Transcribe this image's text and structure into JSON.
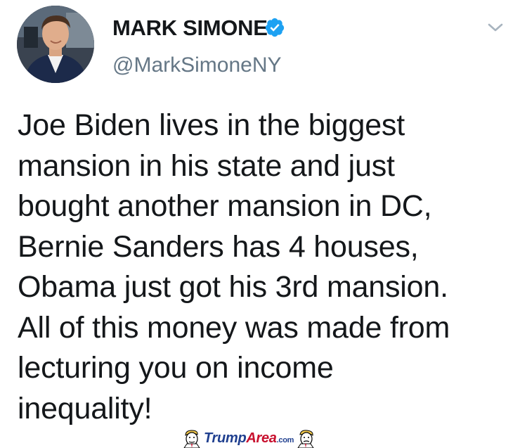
{
  "profile": {
    "display_name": "MARK SIMONE",
    "handle": "@MarkSimoneNY",
    "verified": true,
    "avatar_icon": "profile-photo",
    "menu_icon": "chevron-down-icon"
  },
  "tweet": {
    "lines": [
      "Joe Biden lives in the biggest",
      "mansion in his state and just",
      "bought another mansion in DC,",
      "Bernie Sanders has 4 houses,",
      "Obama just got his 3rd mansion.",
      "All of this money was made from",
      "lecturing you on income",
      "inequality!"
    ]
  },
  "watermark": {
    "part1": "Trump",
    "part2": "Area",
    "part3": ".com"
  },
  "colors": {
    "verified_badge": "#1da1f2",
    "handle": "#657786",
    "text": "#14171a",
    "watermark_blue": "#1f3f8f",
    "watermark_red": "#c8102e"
  }
}
